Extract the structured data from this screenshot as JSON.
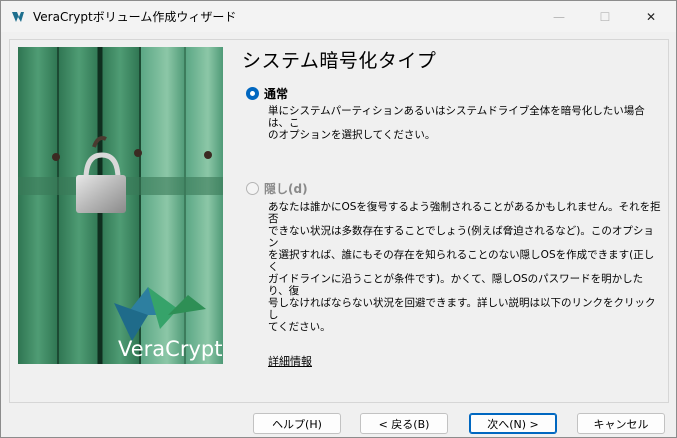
{
  "window": {
    "title": "VeraCryptボリューム作成ウィザード",
    "controls": {
      "minimize": "—",
      "maximize": "☐",
      "close": "✕"
    }
  },
  "page": {
    "title": "システム暗号化タイプ"
  },
  "options": [
    {
      "label": "通常",
      "selected": true,
      "enabled": true,
      "description_lines": [
        "単にシステムパーティションあるいはシステムドライブ全体を暗号化したい場合は、こ",
        "のオプションを選択してください。"
      ]
    },
    {
      "label": "隠し(d)",
      "selected": false,
      "enabled": false,
      "description_lines": [
        "あなたは誰かにOSを復号するよう強制されることがあるかもしれません。それを拒否",
        "できない状況は多数存在することでしょう(例えば脅迫されるなど)。このオプション",
        "を選択すれば、誰にもその存在を知られることのない隠しOSを作成できます(正しく",
        "ガイドラインに沿うことが条件です)。かくて、隠しOSのパスワードを明かしたり、復",
        "号しなければならない状況を回避できます。詳しい説明は以下のリンクをクリックし",
        "てください。"
      ]
    }
  ],
  "links": {
    "more_info": "詳細情報"
  },
  "illustration": {
    "brand_text": "VeraCrypt"
  },
  "buttons": {
    "help": "ヘルプ(H)",
    "back": "< 戻る(B)",
    "next": "次へ(N) >",
    "cancel": "キャンセル"
  },
  "colors": {
    "accent": "#0067c0",
    "door_green": "#3f8a63"
  }
}
